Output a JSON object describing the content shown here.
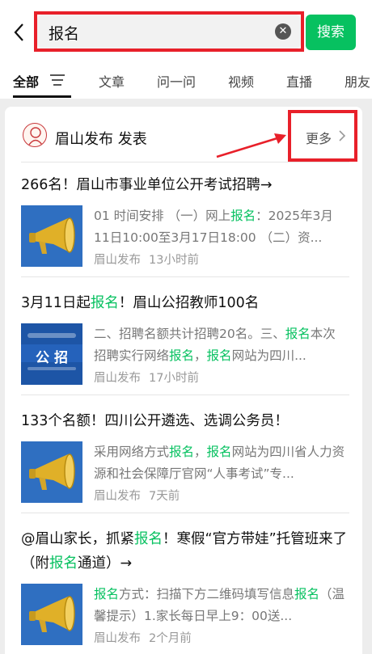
{
  "search": {
    "query": "报名",
    "button_label": "搜索"
  },
  "tabs": [
    "全部",
    "文章",
    "问一问",
    "视频",
    "直播",
    "朋友"
  ],
  "account": {
    "name": "眉山发布 发表",
    "more_label": "更多"
  },
  "articles": [
    {
      "title": "266名！眉山市事业单位公开考试招聘→",
      "snippet": [
        "01 时间安排 （一）网上",
        "报名",
        "：2025年3月11日10:00至3月17日18:00 （二）资..."
      ],
      "source": "眉山发布",
      "time": "13小时前",
      "thumb": "megaphone-image"
    },
    {
      "title": [
        "3月11日起",
        "报名",
        "！眉山公招教师100名"
      ],
      "snippet": [
        "二、招聘名额共计招聘20名。三、",
        "报名",
        "本次招聘实行网络",
        "报名",
        "，",
        "报名",
        "网站为四川..."
      ],
      "source": "眉山发布",
      "time": "17小时前",
      "thumb": "gongzhao-image",
      "thumb_text": "公 招"
    },
    {
      "title": "133个名额！四川公开遴选、选调公务员！",
      "snippet": [
        "采用网络方式",
        "报名",
        "，",
        "报名",
        "网站为四川省人力资源和社会保障厅官网“人事考试”专..."
      ],
      "source": "眉山发布",
      "time": "7天前",
      "thumb": "megaphone-image"
    },
    {
      "title": [
        "@眉山家长，抓紧",
        "报名",
        "！寒假“官方带娃”托管班来了（附",
        "报名",
        "通道）→"
      ],
      "snippet": [
        "报名",
        "方式：扫描下方二维码填写信息",
        "报名",
        "（温馨提示）1.家长每日早上9：00送..."
      ],
      "source": "眉山发布",
      "time": "2个月前",
      "thumb": "megaphone-image"
    }
  ],
  "colors": {
    "accent_green": "#07c160",
    "highlight_red": "#e8202a"
  }
}
